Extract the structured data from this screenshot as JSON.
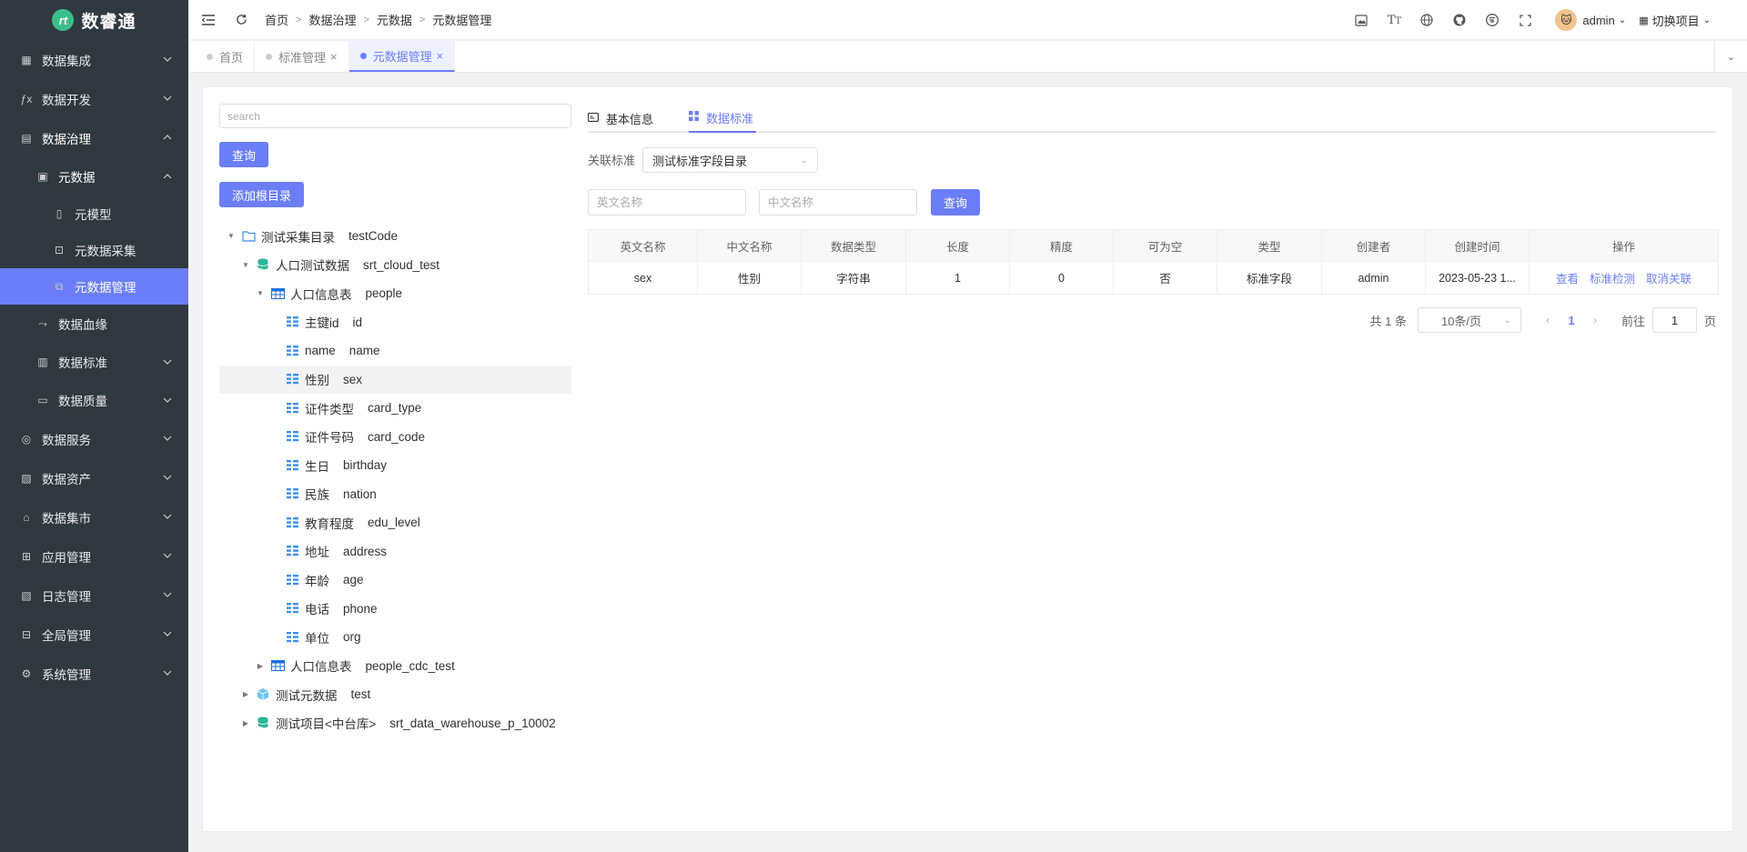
{
  "app": {
    "name": "数睿通",
    "logo_glyph": "rt"
  },
  "sidebar": {
    "items": [
      {
        "label": "数据集成",
        "icon": "grid-icon",
        "level": 0,
        "state": "collapsed"
      },
      {
        "label": "数据开发",
        "icon": "fx-icon",
        "level": 0,
        "state": "collapsed"
      },
      {
        "label": "数据治理",
        "icon": "table-icon",
        "level": 0,
        "state": "expanded"
      },
      {
        "label": "元数据",
        "icon": "document-icon",
        "level": 1,
        "state": "expanded"
      },
      {
        "label": "元模型",
        "icon": "file-icon",
        "level": 2,
        "state": "none"
      },
      {
        "label": "元数据采集",
        "icon": "collect-icon",
        "level": 2,
        "state": "none"
      },
      {
        "label": "元数据管理",
        "icon": "manage-icon",
        "level": 2,
        "state": "active"
      },
      {
        "label": "数据血缘",
        "icon": "lineage-icon",
        "level": 1,
        "state": "none"
      },
      {
        "label": "数据标准",
        "icon": "standard-icon",
        "level": 1,
        "state": "collapsed"
      },
      {
        "label": "数据质量",
        "icon": "quality-icon",
        "level": 1,
        "state": "collapsed"
      },
      {
        "label": "数据服务",
        "icon": "service-icon",
        "level": 0,
        "state": "collapsed"
      },
      {
        "label": "数据资产",
        "icon": "asset-icon",
        "level": 0,
        "state": "collapsed"
      },
      {
        "label": "数据集市",
        "icon": "market-icon",
        "level": 0,
        "state": "collapsed"
      },
      {
        "label": "应用管理",
        "icon": "apps-icon",
        "level": 0,
        "state": "collapsed"
      },
      {
        "label": "日志管理",
        "icon": "log-icon",
        "level": 0,
        "state": "collapsed"
      },
      {
        "label": "全局管理",
        "icon": "global-icon",
        "level": 0,
        "state": "collapsed"
      },
      {
        "label": "系统管理",
        "icon": "gear-icon",
        "level": 0,
        "state": "collapsed"
      }
    ]
  },
  "header": {
    "breadcrumb": [
      "首页",
      "数据治理",
      "元数据",
      "元数据管理"
    ],
    "user": "admin",
    "switch_project": "切换项目"
  },
  "page_tabs": [
    {
      "label": "首页",
      "closable": false,
      "active": false
    },
    {
      "label": "标准管理",
      "closable": true,
      "active": false
    },
    {
      "label": "元数据管理",
      "closable": true,
      "active": true
    }
  ],
  "tree_panel": {
    "search_placeholder": "search",
    "query_button": "查询",
    "add_root_button": "添加根目录",
    "nodes": [
      {
        "cn": "测试采集目录",
        "en": "testCode",
        "depth": 0,
        "type": "folder",
        "expand": "open",
        "selected": false
      },
      {
        "cn": "人口测试数据",
        "en": "srt_cloud_test",
        "depth": 1,
        "type": "database",
        "expand": "open",
        "selected": false
      },
      {
        "cn": "人口信息表",
        "en": "people",
        "depth": 2,
        "type": "table",
        "expand": "open",
        "selected": false
      },
      {
        "cn": "主键id",
        "en": "id",
        "depth": 3,
        "type": "column",
        "expand": "none",
        "selected": false
      },
      {
        "cn": "name",
        "en": "name",
        "depth": 3,
        "type": "column",
        "expand": "none",
        "selected": false
      },
      {
        "cn": "性别",
        "en": "sex",
        "depth": 3,
        "type": "column",
        "expand": "none",
        "selected": true
      },
      {
        "cn": "证件类型",
        "en": "card_type",
        "depth": 3,
        "type": "column",
        "expand": "none",
        "selected": false
      },
      {
        "cn": "证件号码",
        "en": "card_code",
        "depth": 3,
        "type": "column",
        "expand": "none",
        "selected": false
      },
      {
        "cn": "生日",
        "en": "birthday",
        "depth": 3,
        "type": "column",
        "expand": "none",
        "selected": false
      },
      {
        "cn": "民族",
        "en": "nation",
        "depth": 3,
        "type": "column",
        "expand": "none",
        "selected": false
      },
      {
        "cn": "教育程度",
        "en": "edu_level",
        "depth": 3,
        "type": "column",
        "expand": "none",
        "selected": false
      },
      {
        "cn": "地址",
        "en": "address",
        "depth": 3,
        "type": "column",
        "expand": "none",
        "selected": false
      },
      {
        "cn": "年龄",
        "en": "age",
        "depth": 3,
        "type": "column",
        "expand": "none",
        "selected": false
      },
      {
        "cn": "电话",
        "en": "phone",
        "depth": 3,
        "type": "column",
        "expand": "none",
        "selected": false
      },
      {
        "cn": "单位",
        "en": "org",
        "depth": 3,
        "type": "column",
        "expand": "none",
        "selected": false
      },
      {
        "cn": "人口信息表",
        "en": "people_cdc_test",
        "depth": 2,
        "type": "table",
        "expand": "closed",
        "selected": false
      },
      {
        "cn": "测试元数据",
        "en": "test",
        "depth": 1,
        "type": "cube",
        "expand": "closed",
        "selected": false
      },
      {
        "cn": "测试项目<中台库>",
        "en": "srt_data_warehouse_p_10002",
        "depth": 1,
        "type": "database",
        "expand": "closed",
        "selected": false
      }
    ]
  },
  "detail": {
    "tabs": [
      {
        "label": "基本信息",
        "icon": "info-card-icon",
        "active": false
      },
      {
        "label": "数据标准",
        "icon": "grid-icon",
        "active": true
      }
    ],
    "related_label": "关联标准",
    "related_value": "测试标准字段目录",
    "en_name_placeholder": "英文名称",
    "cn_name_placeholder": "中文名称",
    "query_button": "查询",
    "table": {
      "columns": [
        "英文名称",
        "中文名称",
        "数据类型",
        "长度",
        "精度",
        "可为空",
        "类型",
        "创建者",
        "创建时间",
        "操作"
      ],
      "rows": [
        {
          "cells": [
            "sex",
            "性别",
            "字符串",
            "1",
            "0",
            "否",
            "标准字段",
            "admin",
            "2023-05-23 1..."
          ],
          "actions": [
            "查看",
            "标准检测",
            "取消关联"
          ]
        }
      ]
    },
    "pagination": {
      "total": "共 1 条",
      "page_size": "10条/页",
      "current": "1",
      "goto_prefix": "前往",
      "goto_value": "1",
      "goto_suffix": "页"
    }
  },
  "colors": {
    "sidebar_bg": "#2f3a40",
    "accent": "#6c7ef7",
    "logo": "#3bbf8a"
  }
}
